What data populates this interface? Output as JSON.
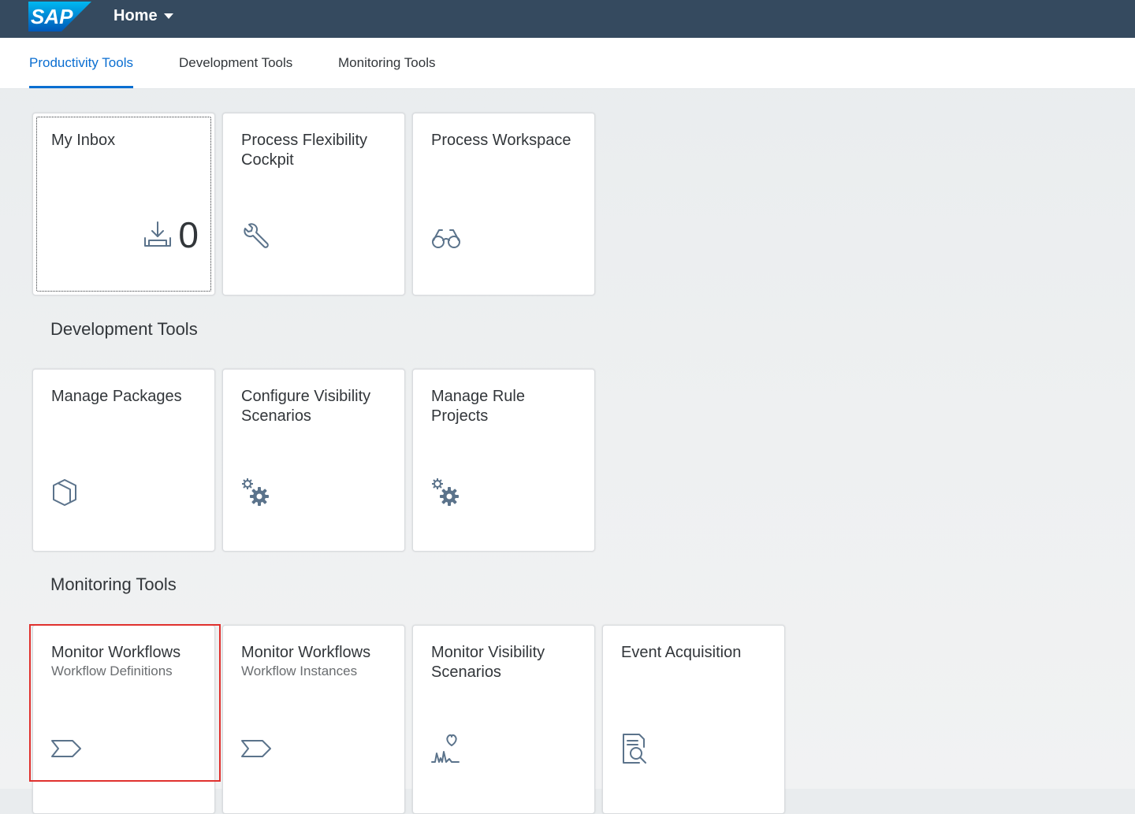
{
  "shell": {
    "logo_text": "SAP",
    "home_label": "Home"
  },
  "nav": {
    "tabs": [
      {
        "label": "Productivity Tools",
        "selected": true
      },
      {
        "label": "Development Tools",
        "selected": false
      },
      {
        "label": "Monitoring Tools",
        "selected": false
      }
    ]
  },
  "groups": {
    "productivity": {
      "tiles": [
        {
          "title": "My Inbox",
          "icon": "inbox-download-icon",
          "count": "0"
        },
        {
          "title": "Process Flexibility Cockpit",
          "icon": "wrench-icon"
        },
        {
          "title": "Process Workspace",
          "icon": "glasses-icon"
        }
      ]
    },
    "development": {
      "title": "Development Tools",
      "tiles": [
        {
          "title": "Manage Packages",
          "icon": "package-icon"
        },
        {
          "title": "Configure Visibility Scenarios",
          "icon": "gears-icon"
        },
        {
          "title": "Manage Rule Projects",
          "icon": "gears-icon"
        }
      ]
    },
    "monitoring": {
      "title": "Monitoring Tools",
      "tiles": [
        {
          "title": "Monitor Workflows",
          "subtitle": "Workflow Definitions",
          "icon": "process-chevron-icon"
        },
        {
          "title": "Monitor Workflows",
          "subtitle": "Workflow Instances",
          "icon": "process-chevron-icon"
        },
        {
          "title": "Monitor Visibility Scenarios",
          "icon": "heart-pulse-icon"
        },
        {
          "title": "Event Acquisition",
          "icon": "document-search-icon"
        }
      ]
    }
  },
  "colors": {
    "shell": "#354a5f",
    "accent": "#0a6ed1",
    "icon": "#5b738b",
    "highlight": "#e0312e"
  }
}
